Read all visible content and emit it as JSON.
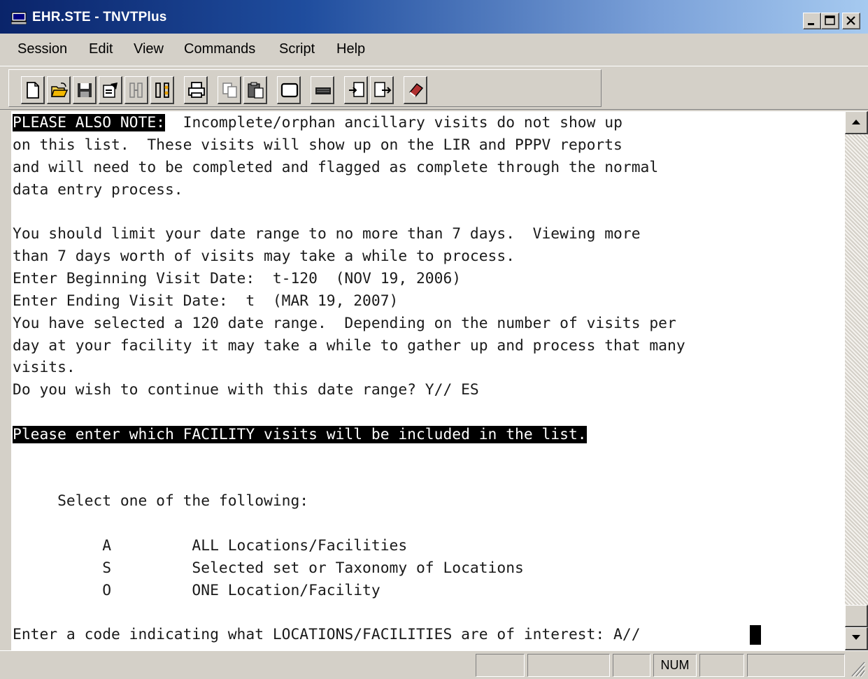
{
  "window": {
    "title": "EHR.STE - TNVTPlus"
  },
  "menu": {
    "items": [
      "Session",
      "Edit",
      "View",
      "Commands",
      "Script",
      "Help"
    ]
  },
  "toolbar": {
    "buttons": [
      "new-document-icon",
      "open-folder-icon",
      "save-disk-icon",
      "properties-icon",
      "connect-icon",
      "disconnect-icon",
      "print-icon",
      "copy-icon",
      "paste-icon",
      "window-icon",
      "keyboard-icon",
      "send-file-icon",
      "receive-file-icon",
      "help-book-icon"
    ]
  },
  "terminal": {
    "lines": [
      {
        "hl": "PLEASE ALSO NOTE:",
        "text": "  Incomplete/orphan ancillary visits do not show up"
      },
      {
        "text": "on this list.  These visits will show up on the LIR and PPPV reports"
      },
      {
        "text": "and will need to be completed and flagged as complete through the normal"
      },
      {
        "text": "data entry process."
      },
      {
        "text": ""
      },
      {
        "text": "You should limit your date range to no more than 7 days.  Viewing more"
      },
      {
        "text": "than 7 days worth of visits may take a while to process."
      },
      {
        "text": "Enter Beginning Visit Date:  t-120  (NOV 19, 2006)"
      },
      {
        "text": "Enter Ending Visit Date:  t  (MAR 19, 2007)"
      },
      {
        "text": "You have selected a 120 date range.  Depending on the number of visits per"
      },
      {
        "text": "day at your facility it may take a while to gather up and process that many"
      },
      {
        "text": "visits."
      },
      {
        "text": "Do you wish to continue with this date range? Y// ES"
      },
      {
        "text": ""
      },
      {
        "hl": "Please enter which FACILITY visits will be included in the list.",
        "text": ""
      },
      {
        "text": ""
      },
      {
        "text": ""
      },
      {
        "text": "     Select one of the following:"
      },
      {
        "text": ""
      },
      {
        "text": "          A         ALL Locations/Facilities"
      },
      {
        "text": "          S         Selected set or Taxonomy of Locations"
      },
      {
        "text": "          O         ONE Location/Facility"
      },
      {
        "text": ""
      },
      {
        "text": "Enter a code indicating what LOCATIONS/FACILITIES are of interest: A// "
      }
    ]
  },
  "statusbar": {
    "num_label": "NUM"
  },
  "colors": {
    "title_start": "#0a246a",
    "title_end": "#a6caf0",
    "chrome": "#d4d0c8",
    "terminal_bg": "#ffffff",
    "terminal_fg": "#1a1a1a"
  }
}
